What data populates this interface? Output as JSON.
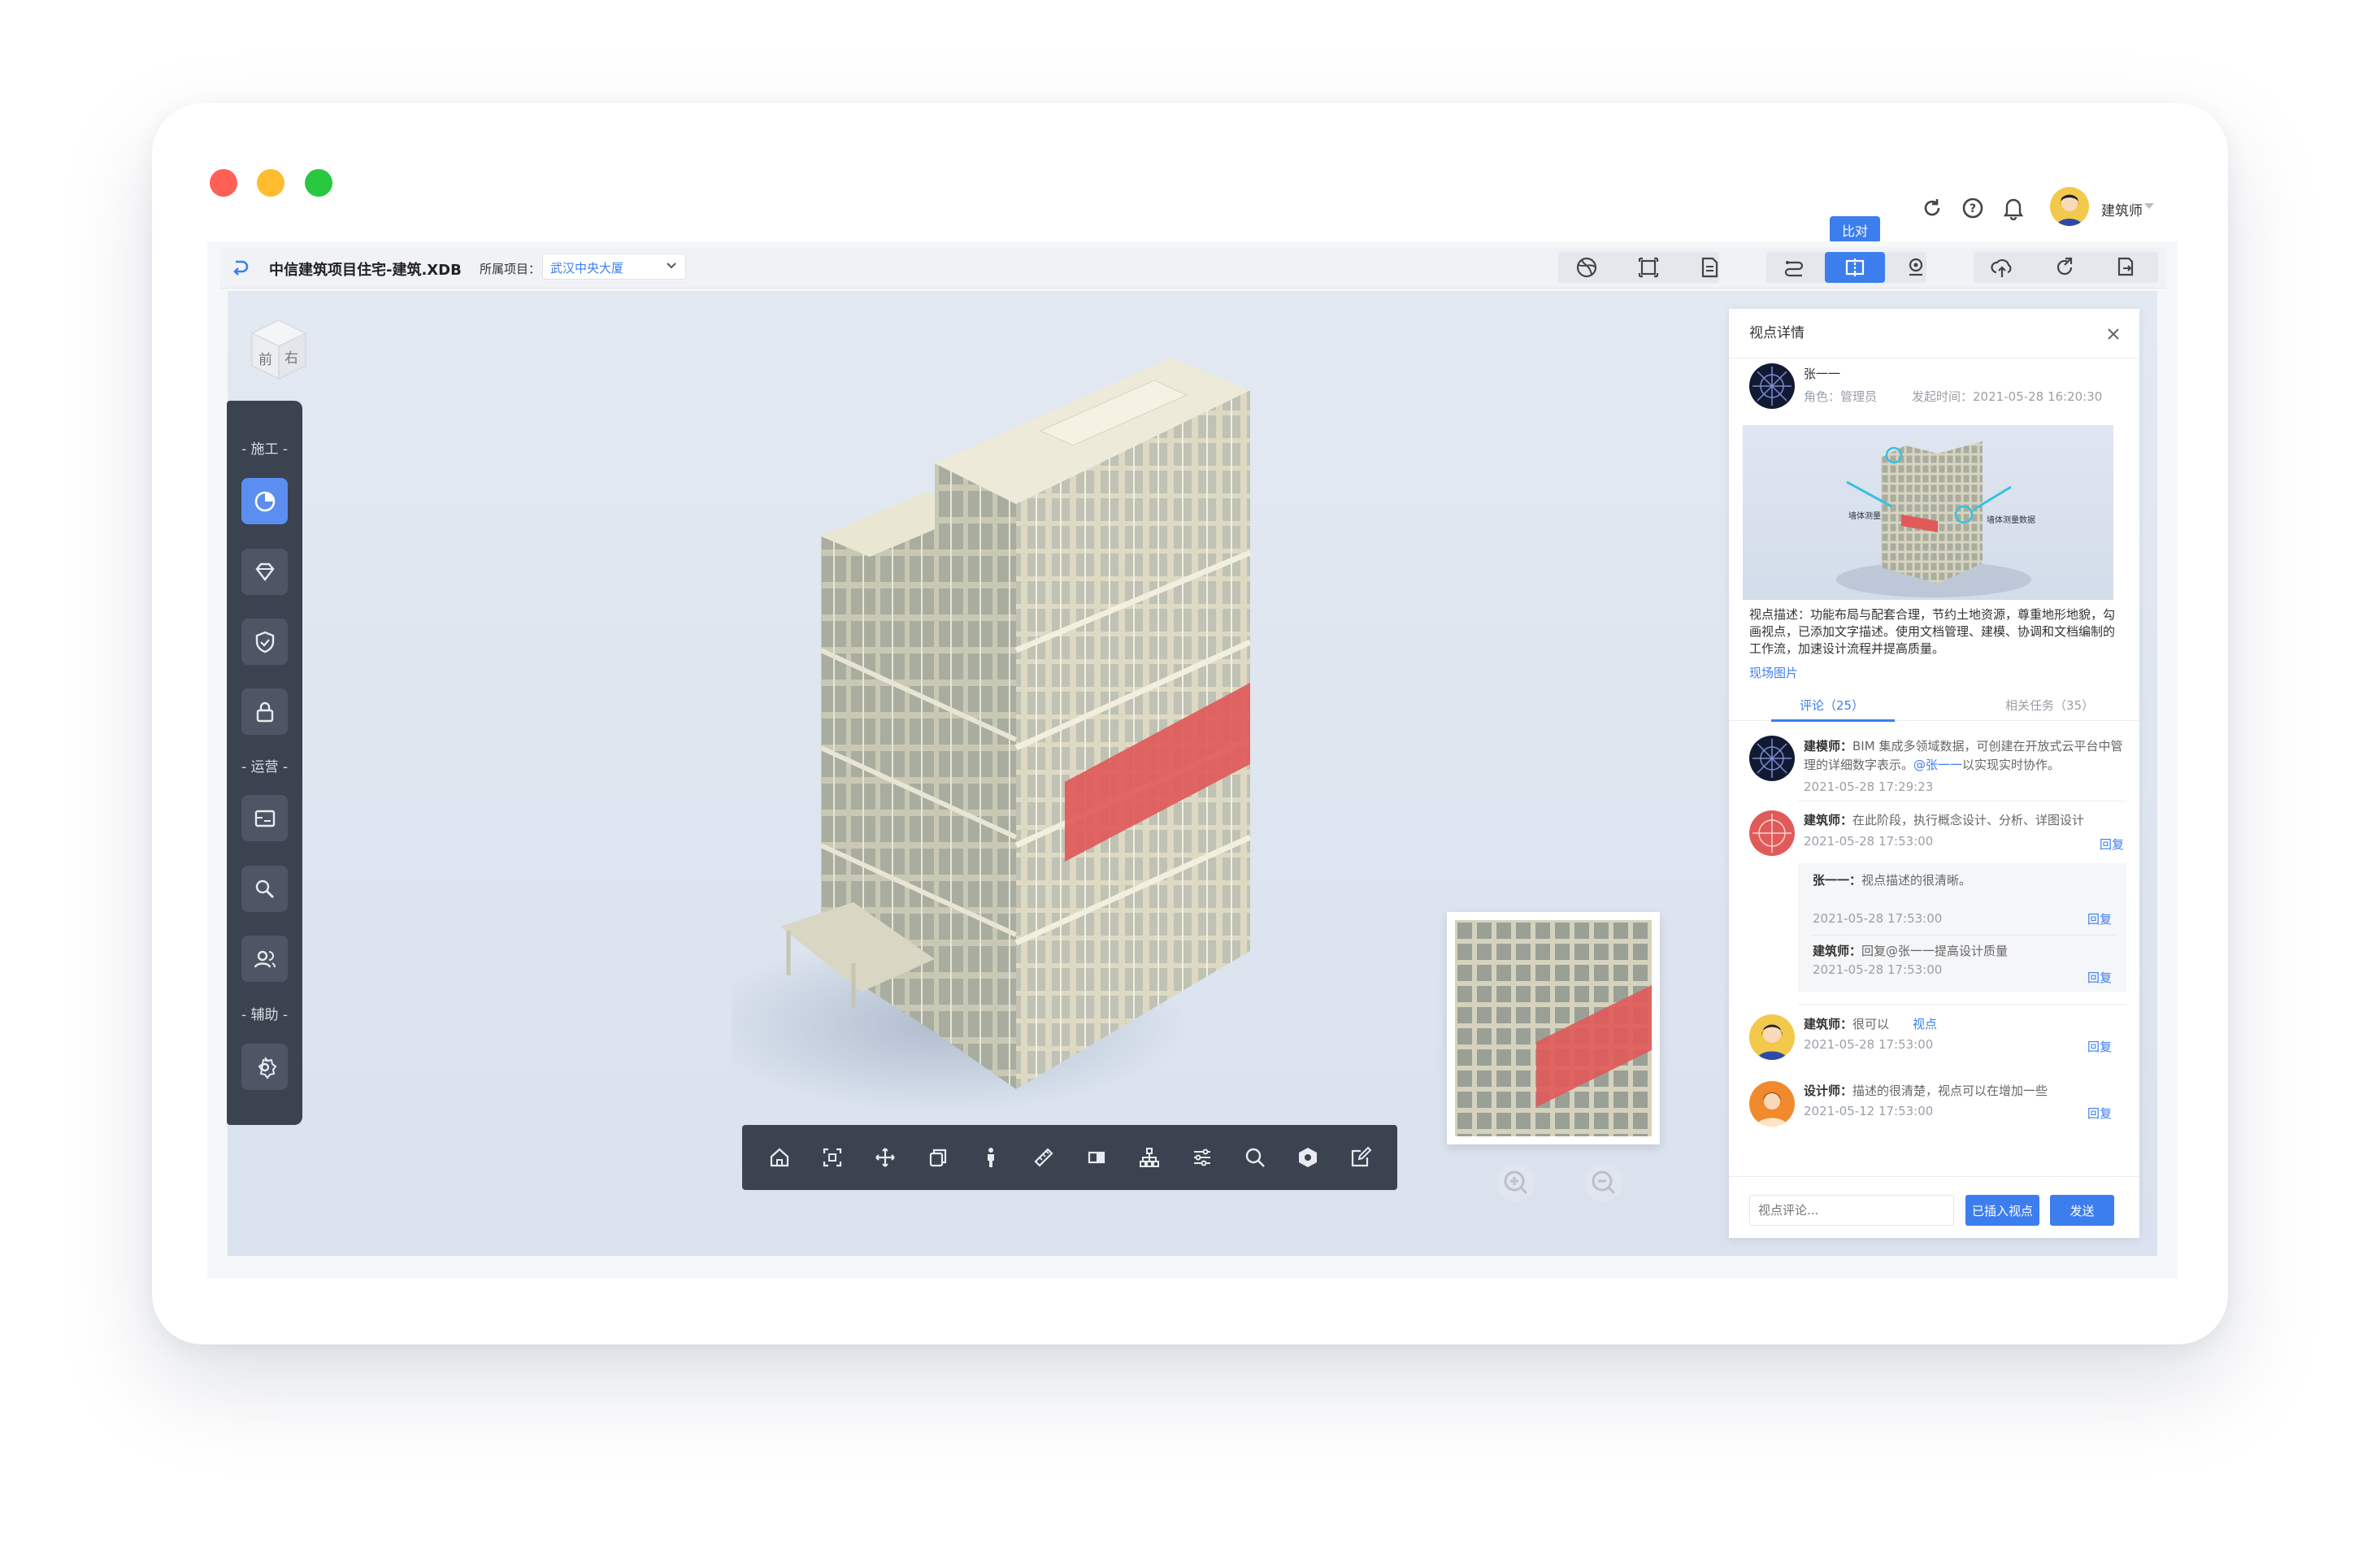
{
  "window": {
    "traffic_lights": [
      "#fe5f57",
      "#febc2e",
      "#28c840"
    ]
  },
  "header": {
    "username": "建筑师",
    "tooltip": "比对"
  },
  "toolbar": {
    "file_title": "中信建筑项目住宅-建筑.XDB",
    "project_label": "所属项目：",
    "project_value": "武汉中央大厦"
  },
  "navcube": {
    "front": "前",
    "right": "右"
  },
  "sidebar": {
    "section_construction": "- 施工 -",
    "section_operation": "- 运营 -",
    "section_auxiliary": "- 辅助 -"
  },
  "panel": {
    "title": "视点详情",
    "author_name": "张一一",
    "role_label": "角色：管理员",
    "time_label": "发起时间：2021-05-28  16:20:30",
    "thumb_label_left": "墙体测量",
    "thumb_label_right": "墙体测量数据",
    "description": "视点描述：功能布局与配套合理，节约土地资源，尊重地形地貌，勾画视点，已添加文字描述。使用文档管理、建模、协调和文档编制的工作流，加速设计流程并提高质量。",
    "site_photos": "现场图片",
    "tab_comments": "评论（25）",
    "tab_tasks": "相关任务（35）",
    "comments": [
      {
        "name": "建模师：",
        "text_a": "BIM 集成多领域数据，可创建在开放式云平台中管理的详细数字表示。",
        "mention": "@张一一",
        "text_b": "以实现实时协作。",
        "time": "2021-05-28  17:29:23"
      },
      {
        "name": "建筑师：",
        "text": "在此阶段，执行概念设计、分析、详图设计",
        "time": "2021-05-28  17:53:00",
        "reply": "回复",
        "subs": [
          {
            "name": "张一一：",
            "text": "视点描述的很清晰。",
            "time": "2021-05-28  17:53:00",
            "reply": "回复"
          },
          {
            "name": "建筑师：",
            "text": "回复@张一一提高设计质量",
            "time": "2021-05-28  17:53:00",
            "reply": "回复"
          }
        ]
      },
      {
        "name": "建筑师：",
        "text": "很可以",
        "link": "视点",
        "time": "2021-05-28  17:53:00",
        "reply": "回复"
      },
      {
        "name": "设计师：",
        "text": "描述的很清楚，视点可以在增加一些",
        "time": "2021-05-12  17:53:00",
        "reply": "回复"
      }
    ],
    "input_placeholder": "视点评论...",
    "insert_button": "已插入视点",
    "send_button": "发送"
  },
  "colors": {
    "accent": "#3d7eef",
    "sidebar": "#3b4350",
    "highlight": "#e05a5a"
  }
}
